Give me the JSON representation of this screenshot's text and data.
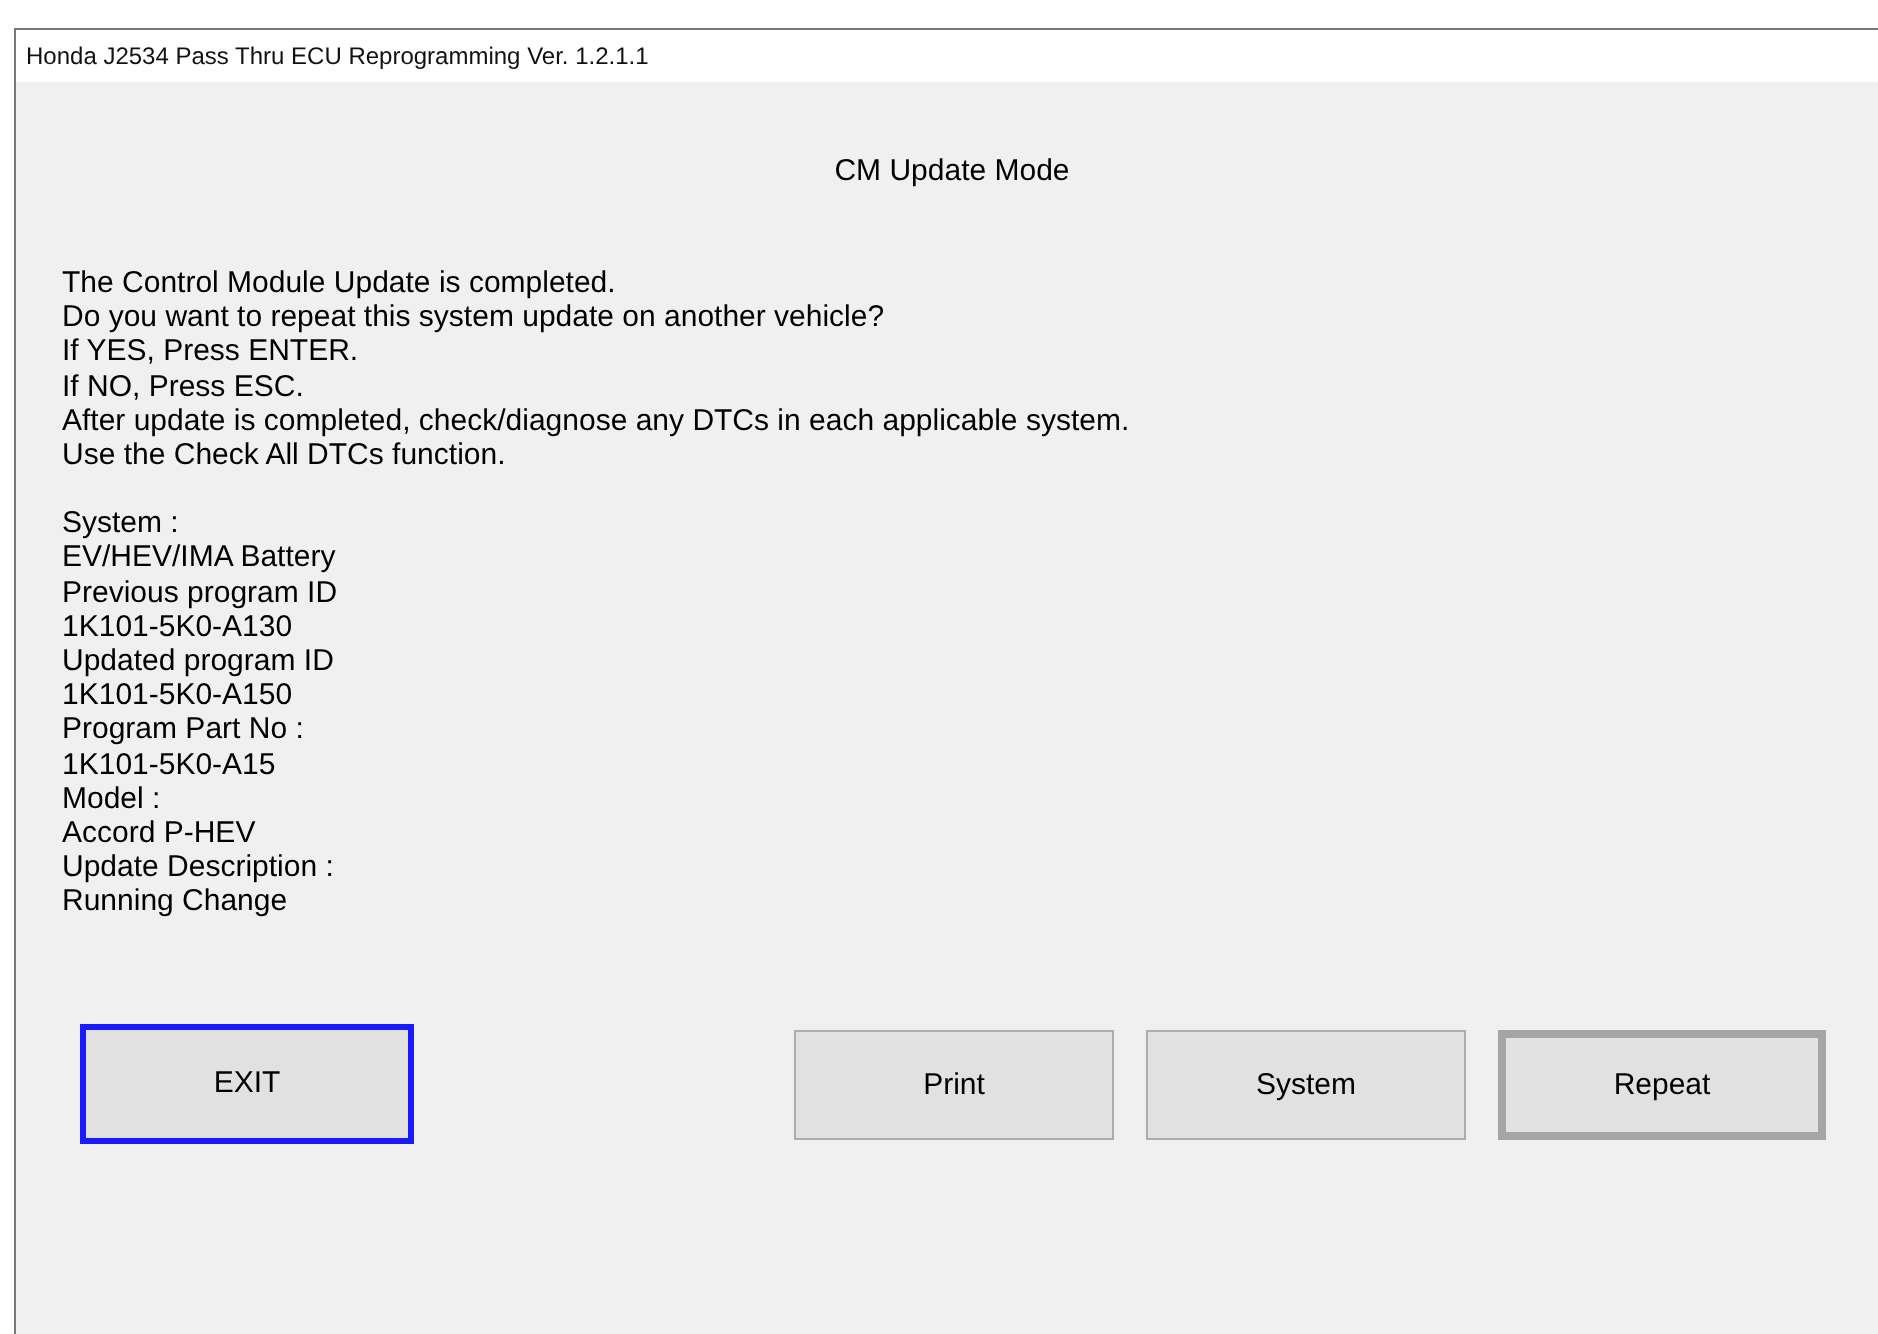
{
  "window": {
    "title": "Honda J2534 Pass Thru ECU Reprogramming Ver. 1.2.1.1"
  },
  "heading": "CM Update Mode",
  "message_lines": [
    "The Control Module Update is completed.",
    "Do you want to repeat this system update on another vehicle?",
    "If YES, Press ENTER.",
    "If NO, Press ESC.",
    "After update is completed, check/diagnose any DTCs in each applicable system.",
    "Use the Check All DTCs function."
  ],
  "info_lines": [
    "System :",
    "EV/HEV/IMA Battery",
    "Previous program ID",
    "1K101-5K0-A130",
    "Updated program ID",
    "1K101-5K0-A150",
    "Program Part No :",
    "1K101-5K0-A15",
    "Model :",
    "Accord P-HEV",
    "Update Description :",
    "Running Change"
  ],
  "buttons": [
    {
      "label": "EXIT",
      "focused": true,
      "default": false
    },
    {
      "label": "Print",
      "focused": false,
      "default": false
    },
    {
      "label": "System",
      "focused": false,
      "default": false
    },
    {
      "label": "Repeat",
      "focused": false,
      "default": true
    }
  ]
}
